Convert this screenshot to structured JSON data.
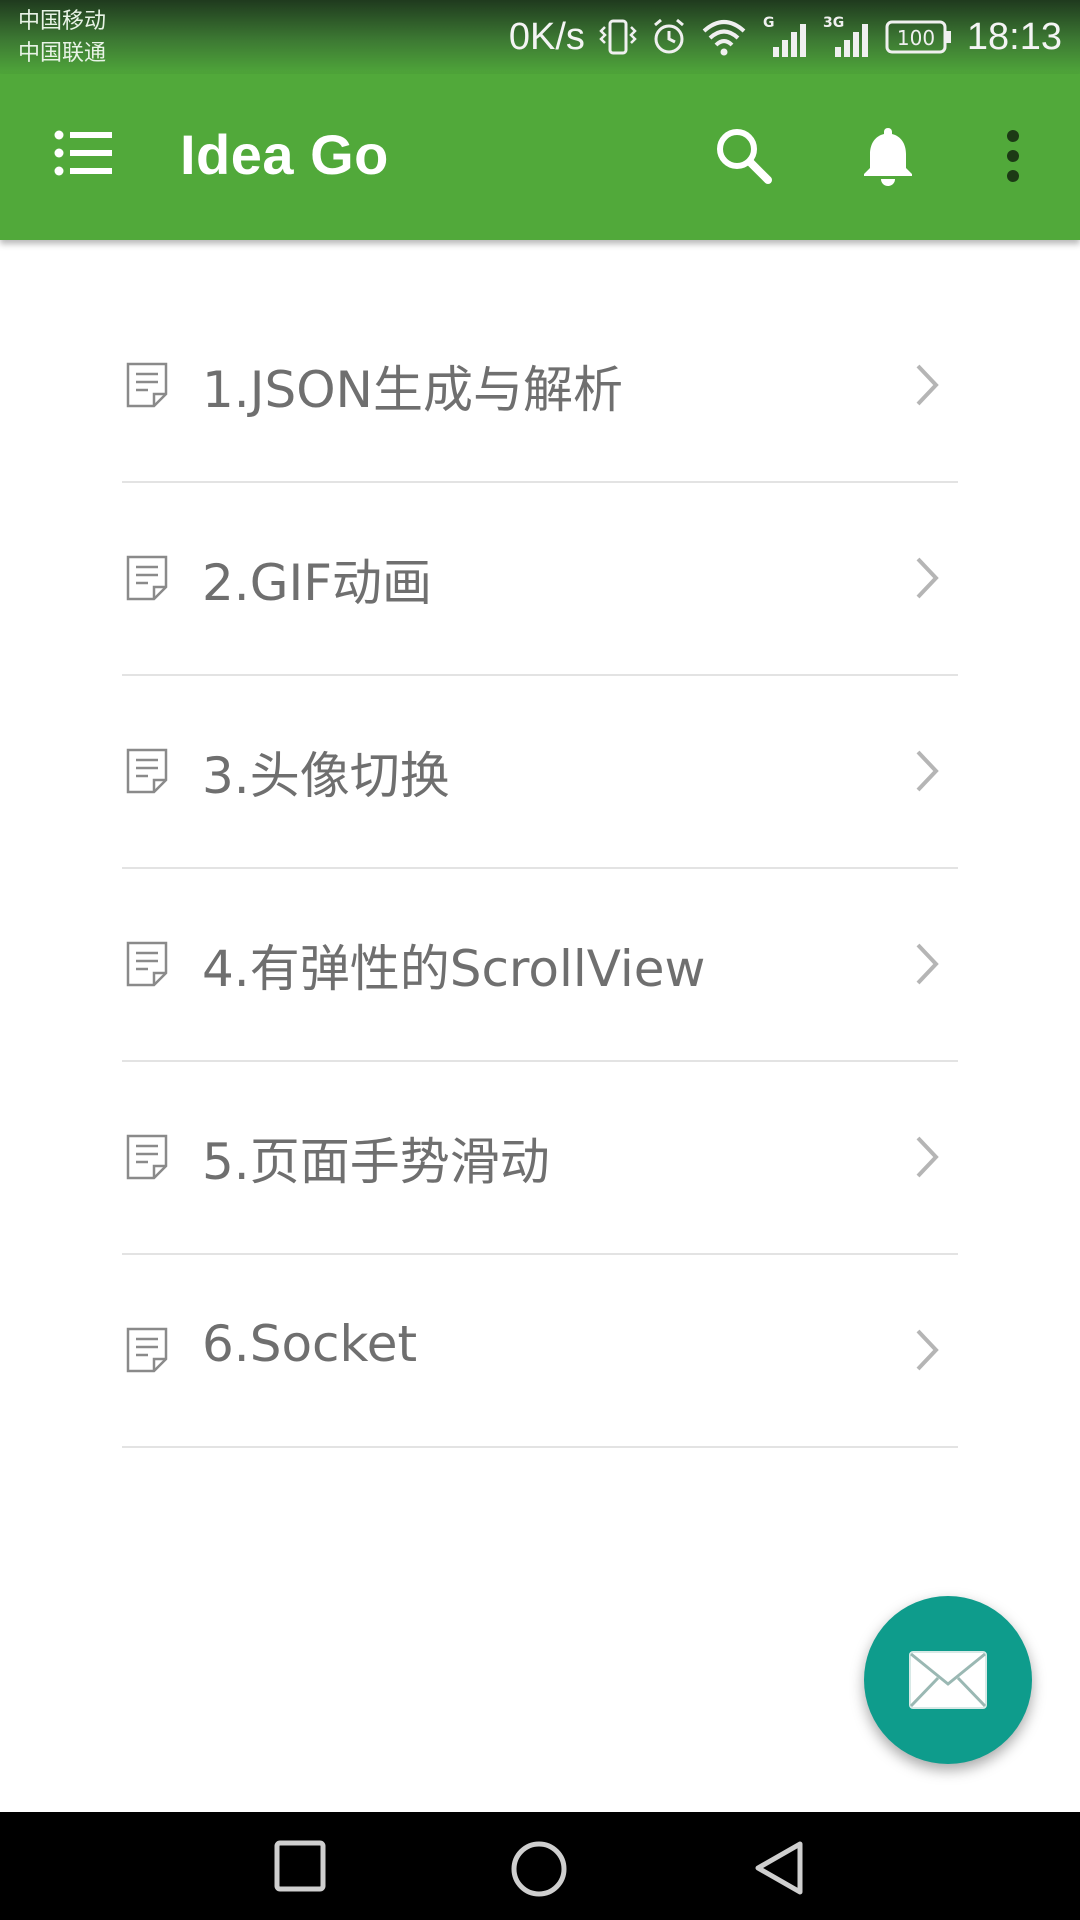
{
  "status_bar": {
    "carrier_1": "中国移动",
    "carrier_2": "中国联通",
    "net_speed": "0K/s",
    "network_1": "G",
    "network_2": "3G",
    "battery": "100",
    "time": "18:13"
  },
  "app_bar": {
    "title": "Idea Go",
    "background_color": "#51a93a"
  },
  "list": {
    "items": [
      {
        "label": "1.JSON生成与解析"
      },
      {
        "label": "2.GIF动画"
      },
      {
        "label": "3.头像切换"
      },
      {
        "label": "4.有弹性的ScrollView"
      },
      {
        "label": "5.页面手势滑动"
      },
      {
        "label": "6.Socket"
      }
    ]
  },
  "fab": {
    "icon": "mail-icon",
    "color": "#0e9c8c"
  },
  "icons": {
    "menu": "menu-icon",
    "search": "search-icon",
    "notifications": "bell-icon",
    "more": "more-vert-icon",
    "list_item": "document-icon",
    "list_arrow": "chevron-right-icon"
  }
}
